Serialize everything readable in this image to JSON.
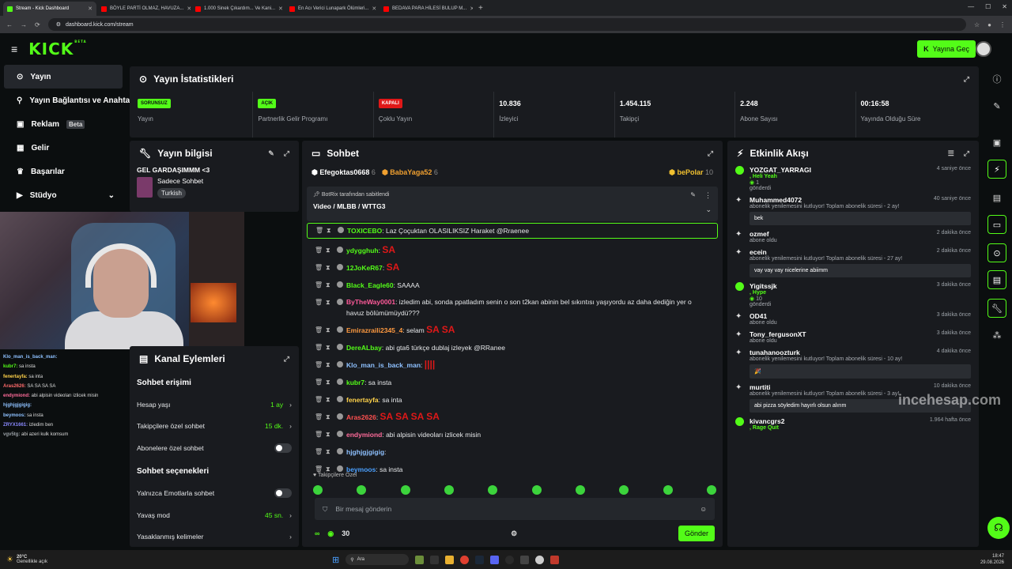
{
  "browser": {
    "tabs": [
      {
        "label": "Stream - Kick Dashboard",
        "color": "#53fc18",
        "active": true
      },
      {
        "label": "BÖYLE PARTİ OLMAZ, HAVUZA...",
        "color": "#ff0000"
      },
      {
        "label": "1.000 Sinek Çıkardım... Ve Kani...",
        "color": "#ff0000"
      },
      {
        "label": "En Acı Verici Lunapark Ölümleri...",
        "color": "#ff0000"
      },
      {
        "label": "BEDAVA PARA HİLESİ BULUP M...",
        "color": "#ff0000"
      }
    ],
    "url": "dashboard.kick.com/stream"
  },
  "topnav": {
    "logo": "KICK",
    "logo_sup": "BETA",
    "golive": "Yayına Geç"
  },
  "sidebar": {
    "items": [
      {
        "label": "Yayın",
        "icon": "circle-dot-icon"
      },
      {
        "label": "Yayın Bağlantısı ve Anahtarı",
        "icon": "link-icon"
      },
      {
        "label": "Reklam",
        "icon": "ad-icon",
        "badge": "Beta"
      },
      {
        "label": "Gelir",
        "icon": "dollar-icon"
      },
      {
        "label": "Başarılar",
        "icon": "trophy-icon"
      },
      {
        "label": "Stüdyo",
        "icon": "video-icon"
      }
    ]
  },
  "stats": {
    "title": "Yayın İstatistikleri",
    "items": [
      {
        "badge": "SORUNSUZ",
        "badge_color": "#53fc18",
        "label": "Yayın"
      },
      {
        "badge": "AÇIK",
        "badge_color": "#53fc18",
        "label": "Partnerlik Gelir Programı"
      },
      {
        "badge": "KAPALI",
        "badge_color": "#e01818",
        "label": "Çoklu Yayın"
      },
      {
        "value": "10.836",
        "label": "İzleyici"
      },
      {
        "value": "1.454.115",
        "label": "Takipçi"
      },
      {
        "value": "2.248",
        "label": "Abone Sayısı"
      },
      {
        "value": "00:16:58",
        "label": "Yayında Olduğu Süre"
      }
    ]
  },
  "info": {
    "title": "Yayın bilgisi",
    "stream_title": "GEL GARDAŞIMMM <3",
    "category": "Sadece Sohbet",
    "tag": "Turkish"
  },
  "overlay_chat": [
    {
      "user": "Klo_man_is_back_man:",
      "text": "",
      "color": "#8ec1ff"
    },
    {
      "user": "kubr7:",
      "text": "sa insta",
      "color": "#53fc18"
    },
    {
      "user": "fenertayfa:",
      "text": "sa inta",
      "color": "#ffd24a"
    },
    {
      "user": "Aras2626:",
      "text": "SA SA SA SA",
      "color": "#ff6b6b"
    },
    {
      "user": "endymiond:",
      "text": "abi alpisin videoları izlicek misin",
      "color": "#ff6b9a"
    },
    {
      "user": "hjghjgjgigig:",
      "text": "",
      "color": "#8ec1ff"
    },
    {
      "user": "beymoos:",
      "text": "sa insta",
      "color": "#8ec1ff"
    },
    {
      "user": "ZRYX1661:",
      "text": "izledim ben",
      "color": "#8a8aff"
    },
    {
      "user": "vgv5tg:",
      "text": "abi azeri kulk komsum",
      "color": "#9aa0a6"
    }
  ],
  "actions": {
    "title": "Kanal Eylemleri",
    "section1": "Sohbet erişimi",
    "rows1": [
      {
        "label": "Hesap yaşı",
        "value": "1 ay"
      },
      {
        "label": "Takipçilere özel sohbet",
        "value": "15 dk."
      },
      {
        "label": "Abonelere özel sohbet",
        "value": ""
      }
    ],
    "section2": "Sohbet seçenekleri",
    "rows2": [
      {
        "label": "Yalnızca Emotlarla sohbet",
        "value": ""
      },
      {
        "label": "Yavaş mod",
        "value": "45 sn."
      },
      {
        "label": "Yasaklanmış kelimeler",
        "value": ""
      }
    ]
  },
  "chat": {
    "title": "Sohbet",
    "top": [
      {
        "user": "Efegoktas0668",
        "count": "6",
        "color": "#fff"
      },
      {
        "user": "BabaYaga52",
        "count": "6",
        "color": "#f0a030"
      },
      {
        "user": "bePolar",
        "count": "10",
        "color": "#f0c030"
      }
    ],
    "pinned_by": "BotRix tarafından sabitlendi",
    "pinned_msg": "Video / MLBB / WTTG3",
    "messages": [
      {
        "user": "TOXICEBO",
        "text": "Laz Çoçuktan OLASILIKSIZ Haraket @Rraenee",
        "color": "#53fc18",
        "sa": ""
      },
      {
        "user": "ydygghuh",
        "text": "",
        "color": "#53fc18",
        "sa": "SA"
      },
      {
        "user": "12JoKeR67",
        "text": "",
        "color": "#53fc18",
        "sa": "SA"
      },
      {
        "user": "Black_Eagle60",
        "text": "SAAAA",
        "color": "#53fc18",
        "sa": ""
      },
      {
        "user": "ByTheWay0001",
        "text": "izledim abi, sonda ppatladım senin o son t2kan abinin bel sıkıntısı yaşıyordu az daha dediğin yer o havuz bölümümüydü???",
        "color": "#ff5a9a",
        "sa": ""
      },
      {
        "user": "Emirazraili2345_4",
        "text": "selam",
        "color": "#ff9a40",
        "sa": "SA SA"
      },
      {
        "user": "DereALbay",
        "text": "abi gta6 türkçe dublaj izleyek @RRanee",
        "color": "#53fc18",
        "sa": ""
      },
      {
        "user": "Klo_man_is_back_man",
        "text": "",
        "color": "#8ec1ff",
        "sa": "||||"
      },
      {
        "user": "kubr7",
        "text": "sa insta",
        "color": "#53fc18",
        "sa": ""
      },
      {
        "user": "fenertayfa",
        "text": "sa inta",
        "color": "#ffd24a",
        "sa": ""
      },
      {
        "user": "Aras2626",
        "text": "",
        "color": "#ff5050",
        "sa": "SA SA SA SA"
      },
      {
        "user": "endymiond",
        "text": "abi alpisin videoları izlicek misin",
        "color": "#ff6b9a",
        "sa": ""
      },
      {
        "user": "hjghjgjgigig",
        "text": "",
        "color": "#8ec1ff",
        "sa": ""
      },
      {
        "user": "beymoos",
        "text": "sa insta",
        "color": "#4aa0ff",
        "sa": ""
      }
    ],
    "followers_only": "Takipçilere Özel",
    "input_placeholder": "Bir mesaj gönderin",
    "points": "30",
    "send": "Gönder"
  },
  "feed": {
    "title": "Etkinlik Akışı",
    "events": [
      {
        "user": "YOZGAT_YARRAGI",
        "time": "4 saniye önce",
        "type": "gift",
        "line": ", Heli Yeah",
        "count": "1",
        "sub": "gönderdi"
      },
      {
        "user": "Muhammed4072",
        "time": "40 saniye önce",
        "type": "resub",
        "sub": "abonelik yenilemesini kutluyor! Toplam abonelik süresi - 2 ay!",
        "note": "bek"
      },
      {
        "user": "ozmef",
        "time": "2 dakika önce",
        "type": "sub",
        "sub": "abone oldu"
      },
      {
        "user": "ecein",
        "time": "2 dakika önce",
        "type": "resub",
        "sub": "abonelik yenilemesini kutluyor! Toplam abonelik süresi - 27 ay!",
        "note": "vay vay vay nicelerine abiimm"
      },
      {
        "user": "Yigitssjk",
        "time": "3 dakika önce",
        "type": "gift",
        "line": ", Hype",
        "count": "10",
        "sub": "gönderdi"
      },
      {
        "user": "OD41",
        "time": "3 dakika önce",
        "type": "sub",
        "sub": "abone oldu"
      },
      {
        "user": "Tony_fergusonXT",
        "time": "3 dakika önce",
        "type": "sub",
        "sub": "abone oldu"
      },
      {
        "user": "tunahanoozturk",
        "time": "4 dakika önce",
        "type": "resub",
        "sub": "abonelik yenilemesini kutluyor! Toplam abonelik süresi - 10 ay!",
        "note": "🎉"
      },
      {
        "user": "murtiti",
        "time": "10 dakika önce",
        "type": "resub",
        "sub": "abonelik yenilemesini kutluyor! Toplam abonelik süresi - 3 ay!",
        "note": "abi pizza söyledim hayırlı olsun alırım"
      },
      {
        "user": "kivancgrs2",
        "time": "1.964 hafta önce",
        "type": "gift",
        "line": ", Rage Quit"
      }
    ]
  },
  "watermark": "incehesap.com",
  "taskbar": {
    "temp": "20°C",
    "weather": "Genellikle açık",
    "search": "Ara",
    "time": "18:47",
    "date": "29.08.2026"
  }
}
